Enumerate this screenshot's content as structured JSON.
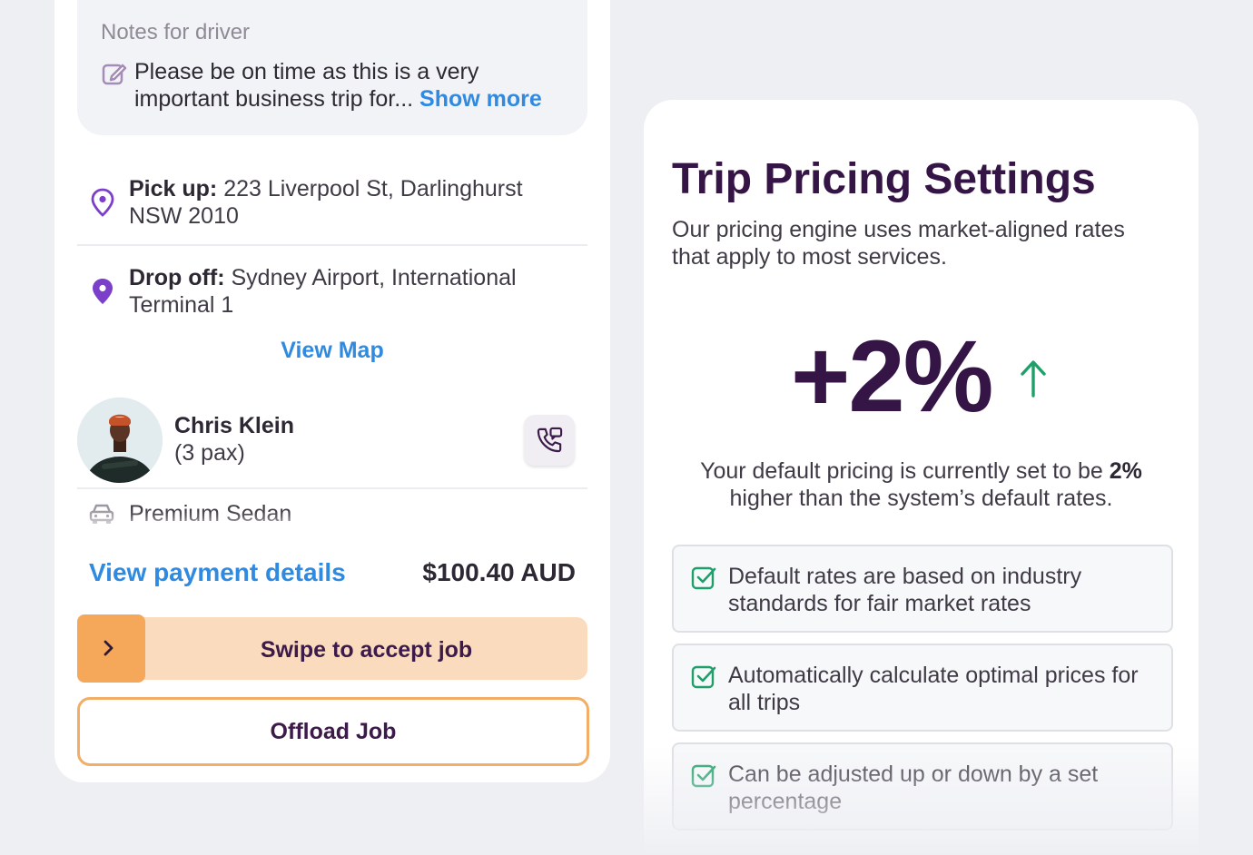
{
  "job": {
    "notes": {
      "title": "Notes for driver",
      "text": "Please be on time as this is a very important business trip for...",
      "show_more": "Show more"
    },
    "pickup": {
      "label": "Pick up:",
      "address": "223 Liverpool St, Darlinghurst NSW 2010"
    },
    "dropoff": {
      "label": "Drop off:",
      "address": "Sydney Airport, International Terminal 1"
    },
    "view_map": "View Map",
    "contact": {
      "name": "Chris Klein",
      "pax": "(3 pax)"
    },
    "vehicle": "Premium Sedan",
    "payment": {
      "link": "View payment details",
      "amount": "$100.40 AUD"
    },
    "swipe_label": "Swipe to accept job",
    "offload_label": "Offload Job"
  },
  "pricing": {
    "title": "Trip Pricing Settings",
    "subtitle": "Our pricing engine uses market-aligned rates that apply to most services.",
    "adjustment": "+2%",
    "description_pre": "Your default pricing is currently set to be",
    "description_value": "2%",
    "description_post": "higher than the system’s default rates.",
    "features": [
      "Default rates are based on industry standards for fair market rates",
      "Automatically calculate optimal prices for all trips",
      "Can be adjusted up or down by a set percentage"
    ]
  },
  "colors": {
    "accent_blue": "#2f8ae0",
    "brand_purple": "#351446",
    "swipe_bg": "#fbdbbd",
    "swipe_handle": "#f5a85a",
    "check_green": "#1fa06a",
    "pin_purple": "#7b3fc9"
  },
  "icons": [
    "edit-note-icon",
    "location-pin-icon",
    "phone-call-icon",
    "car-icon",
    "chevron-right-icon",
    "arrow-up-icon",
    "checkbox-checked-icon"
  ]
}
